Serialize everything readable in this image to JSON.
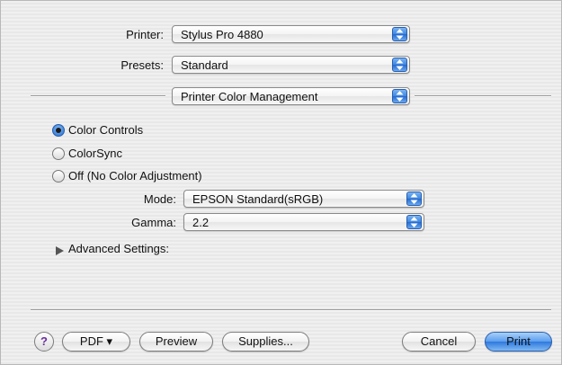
{
  "printer": {
    "label": "Printer:",
    "value": "Stylus Pro 4880"
  },
  "presets": {
    "label": "Presets:",
    "value": "Standard"
  },
  "panel": {
    "value": "Printer Color Management"
  },
  "color_options": [
    {
      "label": "Color Controls",
      "checked": true
    },
    {
      "label": "ColorSync",
      "checked": false
    },
    {
      "label": "Off (No Color Adjustment)",
      "checked": false
    }
  ],
  "mode": {
    "label": "Mode:",
    "value": "EPSON Standard(sRGB)"
  },
  "gamma": {
    "label": "Gamma:",
    "value": "2.2"
  },
  "advanced": {
    "label": "Advanced Settings:"
  },
  "buttons": {
    "help": "?",
    "pdf": "PDF ▾",
    "preview": "Preview",
    "supplies": "Supplies...",
    "cancel": "Cancel",
    "print": "Print"
  },
  "colors": {
    "accent": "#3d86e2",
    "help_icon": "#6a2f9f"
  }
}
